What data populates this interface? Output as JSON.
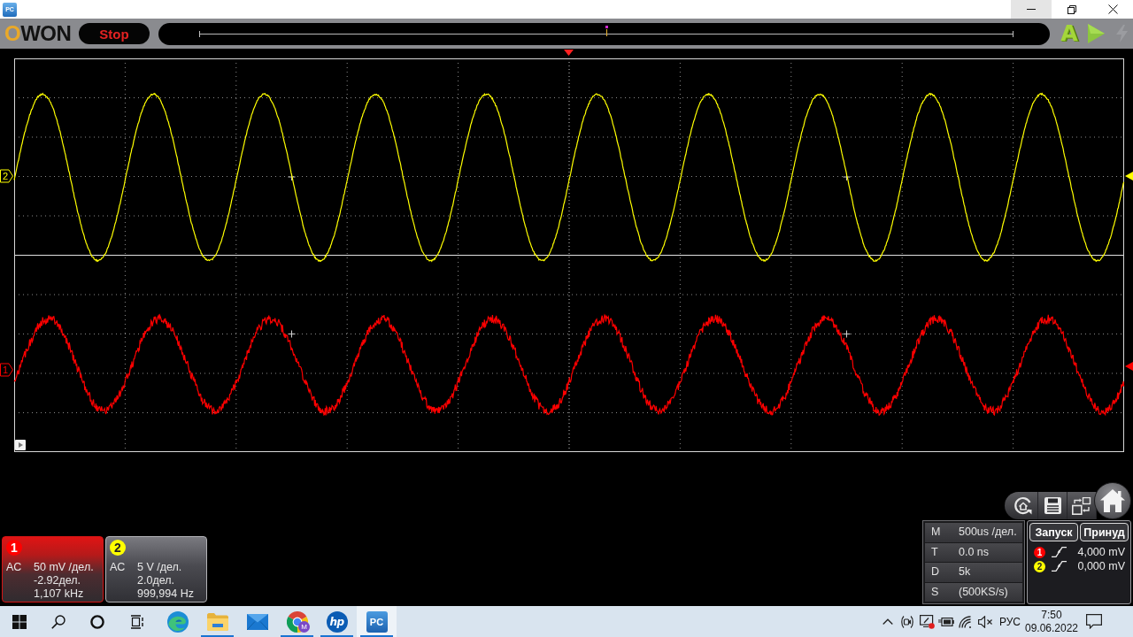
{
  "window": {
    "icon_label": "PC",
    "controls": [
      {
        "kind": "minimize",
        "hovered": true
      },
      {
        "kind": "restore",
        "hovered": false
      },
      {
        "kind": "close",
        "hovered": false
      }
    ]
  },
  "toolbar": {
    "logo": "OWON",
    "run_button": {
      "label": "Stop"
    },
    "timeline": {
      "level": 0.5
    },
    "actions": [
      {
        "kind": "autoset",
        "label": "A",
        "disabled": false
      },
      {
        "kind": "run",
        "disabled": false
      },
      {
        "kind": "force",
        "disabled": true
      }
    ]
  },
  "display": {
    "traces": [
      {
        "label": "2",
        "color": "#ffff00"
      },
      {
        "label": "1",
        "color": "#ff0000"
      }
    ]
  },
  "channel_panels": [
    {
      "badge": "1",
      "color": "#ff0000",
      "selected": true,
      "coupling": "AC",
      "scale": "50 mV /дел.",
      "position": "-2.92дел.",
      "frequency": "1,107 kHz"
    },
    {
      "badge": "2",
      "color": "#ffff00",
      "selected": false,
      "coupling": "AC",
      "scale": "5 V /дел.",
      "position": "2.0дел.",
      "frequency": "999,994 Hz"
    }
  ],
  "quick_buttons": [
    {
      "kind": "reset"
    },
    {
      "kind": "save"
    },
    {
      "kind": "window_switch"
    },
    {
      "kind": "home"
    }
  ],
  "timebase": [
    {
      "key": "M",
      "value": "500us /дел."
    },
    {
      "key": "T",
      "value": "0.0 ns"
    },
    {
      "key": "D",
      "value": "5k"
    },
    {
      "key": "S",
      "value": "(500KS/s)"
    }
  ],
  "trigger": {
    "buttons": [
      "Запуск",
      "Принуд"
    ],
    "sources": [
      {
        "badge": "1",
        "color": "#ff0000",
        "kind": "rising",
        "value": "4,000 mV"
      },
      {
        "badge": "2",
        "color": "#ffff00",
        "kind": "rising",
        "value": "0,000 mV"
      }
    ]
  },
  "taskbar": {
    "buttons": [
      {
        "kind": "start"
      },
      {
        "kind": "search"
      },
      {
        "kind": "cortana"
      },
      {
        "kind": "task_view"
      }
    ],
    "apps": [
      {
        "kind": "edge",
        "running": false,
        "selected": false
      },
      {
        "kind": "explorer",
        "running": true,
        "selected": false
      },
      {
        "kind": "mail",
        "running": false,
        "selected": false
      },
      {
        "kind": "chrome",
        "badge": "M",
        "running": true,
        "selected": false
      },
      {
        "kind": "hp",
        "label": "hp",
        "running": true,
        "selected": false
      },
      {
        "kind": "pc",
        "label": "PC",
        "running": true,
        "selected": true
      }
    ],
    "tray": [
      {
        "kind": "chevron"
      },
      {
        "kind": "meet"
      },
      {
        "kind": "security"
      },
      {
        "kind": "power"
      },
      {
        "kind": "wifi"
      },
      {
        "kind": "volume",
        "muted": true
      }
    ],
    "language": "РУС",
    "time": "7:50",
    "date": "09.06.2022"
  }
}
